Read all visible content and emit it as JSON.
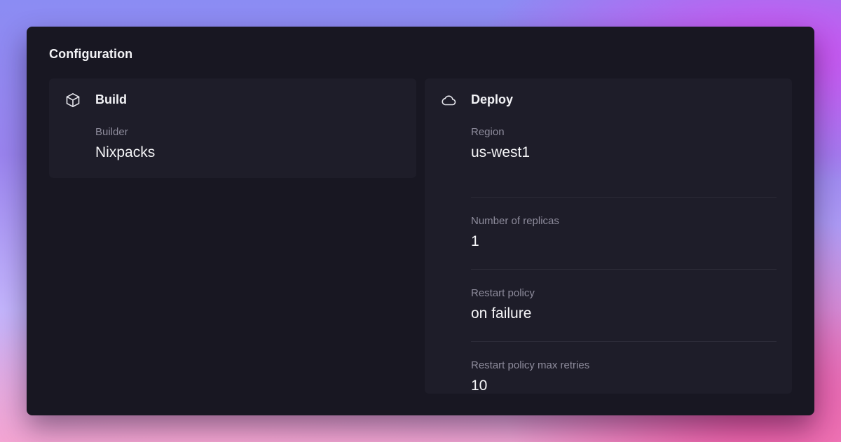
{
  "window": {
    "title": "Configuration"
  },
  "build": {
    "title": "Build",
    "icon": "box-icon",
    "fields": [
      {
        "label": "Builder",
        "value": "Nixpacks"
      }
    ]
  },
  "deploy": {
    "title": "Deploy",
    "icon": "cloud-icon",
    "fields": [
      {
        "label": "Region",
        "value": "us-west1"
      },
      {
        "label": "Number of replicas",
        "value": "1"
      },
      {
        "label": "Restart policy",
        "value": "on failure"
      },
      {
        "label": "Restart policy max retries",
        "value": "10"
      }
    ]
  },
  "colors": {
    "window_bg": "#181722",
    "card_bg": "#1e1d29",
    "label": "#8e8c9c",
    "value": "#f5f5f7"
  }
}
